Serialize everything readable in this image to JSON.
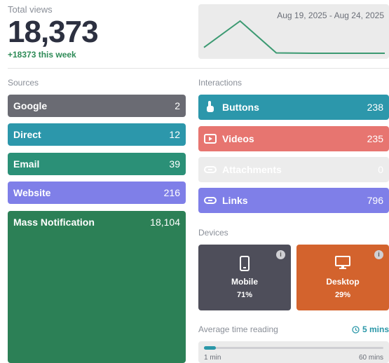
{
  "total": {
    "label": "Total views",
    "value": "18,373",
    "week": "+18373 this week"
  },
  "range": "Aug 19, 2025 - Aug 24, 2025",
  "sparkline": {
    "values": [
      18,
      100,
      1,
      0,
      0,
      0
    ],
    "color": "#3c9a72"
  },
  "sources": {
    "title": "Sources",
    "items": [
      {
        "label": "Google",
        "value": "2",
        "color": "#6a6b73"
      },
      {
        "label": "Direct",
        "value": "12",
        "color": "#2c97ab"
      },
      {
        "label": "Email",
        "value": "39",
        "color": "#2b9077"
      },
      {
        "label": "Website",
        "value": "216",
        "color": "#7f7fe8"
      },
      {
        "label": "Mass Notification",
        "value": "18,104",
        "color": "#2c8056"
      }
    ]
  },
  "interactions": {
    "title": "Interactions",
    "items": [
      {
        "label": "Buttons",
        "value": "238",
        "color": "#2c97ab",
        "icon": "pointer-hand-icon"
      },
      {
        "label": "Videos",
        "value": "235",
        "color": "#e77570",
        "icon": "video-play-icon"
      },
      {
        "label": "Attachments",
        "value": "0",
        "color": "#ececec",
        "icon": "attachment-icon"
      },
      {
        "label": "Links",
        "value": "796",
        "color": "#7f7fe8",
        "icon": "link-icon"
      }
    ]
  },
  "devices": {
    "title": "Devices",
    "items": [
      {
        "label": "Mobile",
        "percent": "71%",
        "color": "#4e4e5a",
        "icon": "mobile-phone-icon"
      },
      {
        "label": "Desktop",
        "percent": "29%",
        "color": "#d3632d",
        "icon": "desktop-monitor-icon"
      }
    ],
    "info_glyph": "i"
  },
  "reading": {
    "label": "Average time reading",
    "value": "5 mins",
    "min_label": "1 min",
    "max_label": "60 mins",
    "progress": 0.068
  }
}
